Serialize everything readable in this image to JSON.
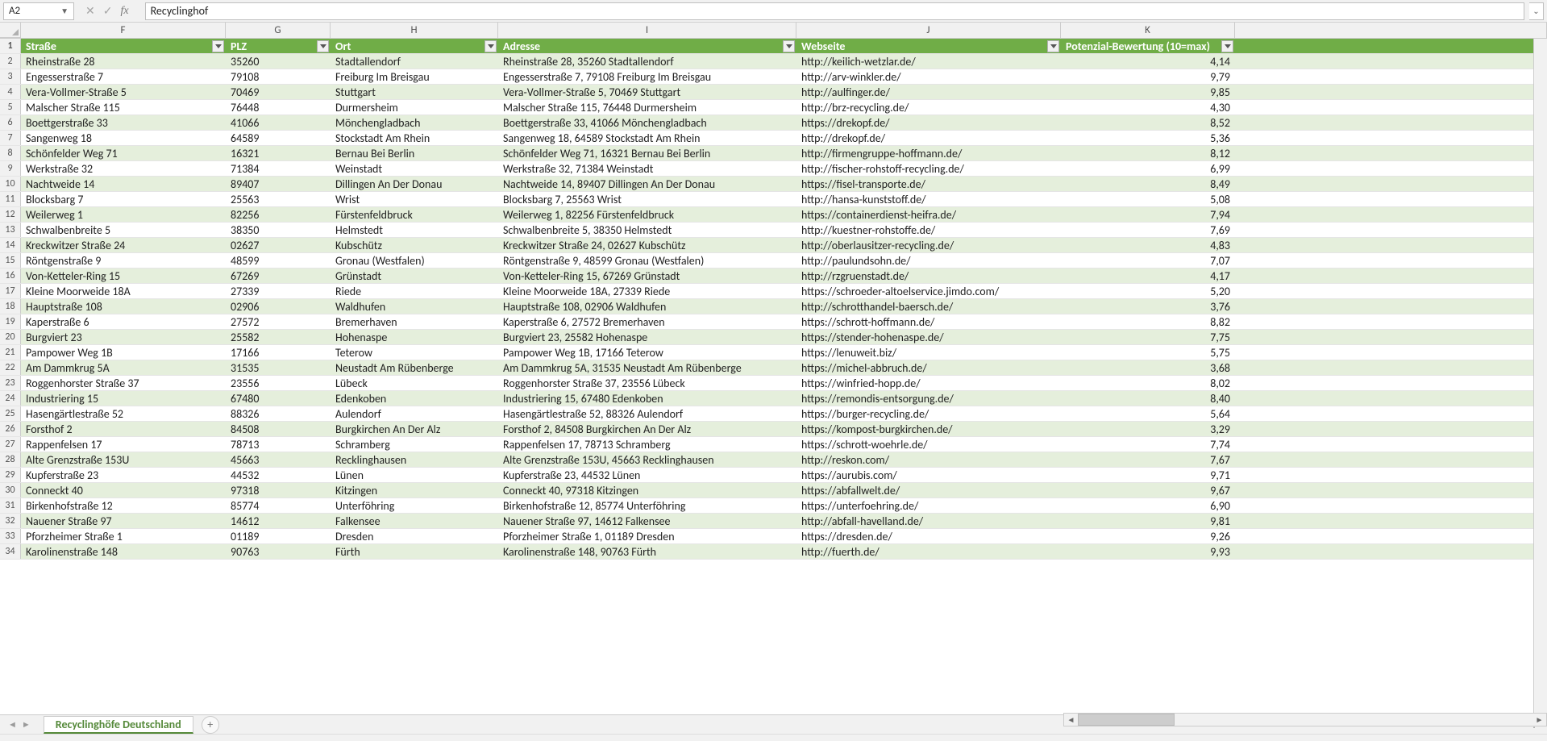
{
  "namebox": "A2",
  "formula": "Recyclinghof",
  "columns": [
    "F",
    "G",
    "H",
    "I",
    "J",
    "K"
  ],
  "headers": {
    "F": "Straße",
    "G": "PLZ",
    "H": "Ort",
    "I": "Adresse",
    "J": "Webseite",
    "K": "Potenzial-Bewertung (10=max)"
  },
  "sheet_tab": "Recyclinghöfe Deutschland",
  "chart_data": {
    "type": "table",
    "columns": [
      "Straße",
      "PLZ",
      "Ort",
      "Adresse",
      "Webseite",
      "Potenzial-Bewertung (10=max)"
    ],
    "rows": [
      [
        "Rheinstraße 28",
        "35260",
        "Stadtallendorf",
        "Rheinstraße 28, 35260 Stadtallendorf",
        "http://keilich-wetzlar.de/",
        "4,14"
      ],
      [
        "Engesserstraße 7",
        "79108",
        "Freiburg Im Breisgau",
        "Engesserstraße 7, 79108 Freiburg Im Breisgau",
        "http://arv-winkler.de/",
        "9,79"
      ],
      [
        "Vera-Vollmer-Straße 5",
        "70469",
        "Stuttgart",
        "Vera-Vollmer-Straße 5, 70469 Stuttgart",
        "http://aulfinger.de/",
        "9,85"
      ],
      [
        "Malscher Straße 115",
        "76448",
        "Durmersheim",
        "Malscher Straße 115, 76448 Durmersheim",
        "http://brz-recycling.de/",
        "4,30"
      ],
      [
        "Boettgerstraße 33",
        "41066",
        "Mönchengladbach",
        "Boettgerstraße 33, 41066 Mönchengladbach",
        "https://drekopf.de/",
        "8,52"
      ],
      [
        "Sangenweg 18",
        "64589",
        "Stockstadt Am Rhein",
        "Sangenweg 18, 64589 Stockstadt Am Rhein",
        "http://drekopf.de/",
        "5,36"
      ],
      [
        "Schönfelder Weg 71",
        "16321",
        "Bernau Bei Berlin",
        "Schönfelder Weg 71, 16321 Bernau Bei Berlin",
        "http://firmengruppe-hoffmann.de/",
        "8,12"
      ],
      [
        "Werkstraße 32",
        "71384",
        "Weinstadt",
        "Werkstraße 32, 71384 Weinstadt",
        "http://fischer-rohstoff-recycling.de/",
        "6,99"
      ],
      [
        "Nachtweide 14",
        "89407",
        "Dillingen An Der Donau",
        "Nachtweide 14, 89407 Dillingen An Der Donau",
        "https://fisel-transporte.de/",
        "8,49"
      ],
      [
        "Blocksbarg 7",
        "25563",
        "Wrist",
        "Blocksbarg 7, 25563 Wrist",
        "http://hansa-kunststoff.de/",
        "5,08"
      ],
      [
        "Weilerweg 1",
        "82256",
        "Fürstenfeldbruck",
        "Weilerweg 1, 82256 Fürstenfeldbruck",
        "https://containerdienst-heifra.de/",
        "7,94"
      ],
      [
        "Schwalbenbreite 5",
        "38350",
        "Helmstedt",
        "Schwalbenbreite 5, 38350 Helmstedt",
        "http://kuestner-rohstoffe.de/",
        "7,69"
      ],
      [
        "Kreckwitzer Straße 24",
        "02627",
        "Kubschütz",
        "Kreckwitzer Straße 24, 02627 Kubschütz",
        "http://oberlausitzer-recycling.de/",
        "4,83"
      ],
      [
        "Röntgenstraße 9",
        "48599",
        "Gronau (Westfalen)",
        "Röntgenstraße 9, 48599 Gronau (Westfalen)",
        "http://paulundsohn.de/",
        "7,07"
      ],
      [
        "Von-Ketteler-Ring 15",
        "67269",
        "Grünstadt",
        "Von-Ketteler-Ring 15, 67269 Grünstadt",
        "http://rzgruenstadt.de/",
        "4,17"
      ],
      [
        "Kleine Moorweide 18A",
        "27339",
        "Riede",
        "Kleine Moorweide 18A, 27339 Riede",
        "https://schroeder-altoelservice.jimdo.com/",
        "5,20"
      ],
      [
        "Hauptstraße 108",
        "02906",
        "Waldhufen",
        "Hauptstraße 108, 02906 Waldhufen",
        "http://schrotthandel-baersch.de/",
        "3,76"
      ],
      [
        "Kaperstraße 6",
        "27572",
        "Bremerhaven",
        "Kaperstraße 6, 27572 Bremerhaven",
        "https://schrott-hoffmann.de/",
        "8,82"
      ],
      [
        "Burgviert 23",
        "25582",
        "Hohenaspe",
        "Burgviert 23, 25582 Hohenaspe",
        "https://stender-hohenaspe.de/",
        "7,75"
      ],
      [
        "Pampower Weg 1B",
        "17166",
        "Teterow",
        "Pampower Weg 1B, 17166 Teterow",
        "https://lenuweit.biz/",
        "5,75"
      ],
      [
        "Am Dammkrug 5A",
        "31535",
        "Neustadt Am Rübenberge",
        "Am Dammkrug 5A, 31535 Neustadt Am Rübenberge",
        "https://michel-abbruch.de/",
        "3,68"
      ],
      [
        "Roggenhorster Straße 37",
        "23556",
        "Lübeck",
        "Roggenhorster Straße 37, 23556 Lübeck",
        "https://winfried-hopp.de/",
        "8,02"
      ],
      [
        "Industriering 15",
        "67480",
        "Edenkoben",
        "Industriering 15, 67480 Edenkoben",
        "https://remondis-entsorgung.de/",
        "8,40"
      ],
      [
        "Hasengärtlestraße 52",
        "88326",
        "Aulendorf",
        "Hasengärtlestraße 52, 88326 Aulendorf",
        "https://burger-recycling.de/",
        "5,64"
      ],
      [
        "Forsthof 2",
        "84508",
        "Burgkirchen An Der Alz",
        "Forsthof 2, 84508 Burgkirchen An Der Alz",
        "https://kompost-burgkirchen.de/",
        "3,29"
      ],
      [
        "Rappenfelsen 17",
        "78713",
        "Schramberg",
        "Rappenfelsen 17, 78713 Schramberg",
        "https://schrott-woehrle.de/",
        "7,74"
      ],
      [
        "Alte Grenzstraße 153U",
        "45663",
        "Recklinghausen",
        "Alte Grenzstraße 153U, 45663 Recklinghausen",
        "http://reskon.com/",
        "7,67"
      ],
      [
        "Kupferstraße 23",
        "44532",
        "Lünen",
        "Kupferstraße 23, 44532 Lünen",
        "https://aurubis.com/",
        "9,71"
      ],
      [
        "Conneckt 40",
        "97318",
        "Kitzingen",
        "Conneckt 40, 97318 Kitzingen",
        "https://abfallwelt.de/",
        "9,67"
      ],
      [
        "Birkenhofstraße 12",
        "85774",
        "Unterföhring",
        "Birkenhofstraße 12, 85774 Unterföhring",
        "https://unterfoehring.de/",
        "6,90"
      ],
      [
        "Nauener Straße 97",
        "14612",
        "Falkensee",
        "Nauener Straße 97, 14612 Falkensee",
        "http://abfall-havelland.de/",
        "9,81"
      ],
      [
        "Pforzheimer Straße 1",
        "01189",
        "Dresden",
        "Pforzheimer Straße 1, 01189 Dresden",
        "https://dresden.de/",
        "9,26"
      ],
      [
        "Karolinenstraße 148",
        "90763",
        "Fürth",
        "Karolinenstraße 148, 90763 Fürth",
        "http://fuerth.de/",
        "9,93"
      ]
    ]
  }
}
